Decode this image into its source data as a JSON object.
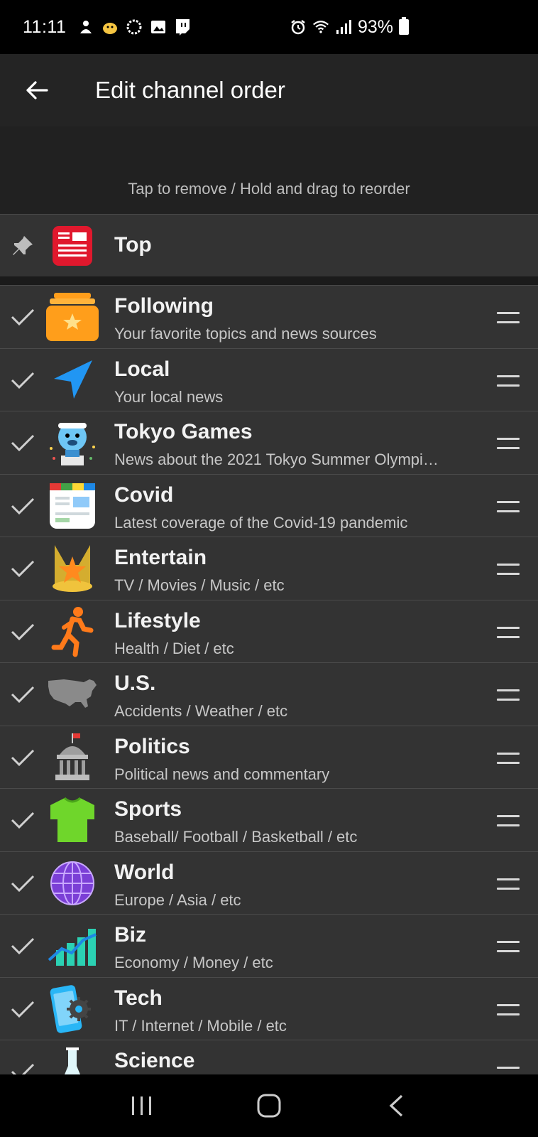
{
  "status": {
    "time": "11:11",
    "battery": "93%"
  },
  "appbar": {
    "title": "Edit channel order"
  },
  "hint": "Tap to remove / Hold and drag to reorder",
  "pinned": {
    "title": "Top",
    "icon": "newspaper-icon",
    "color": "#e0182d"
  },
  "channels": [
    {
      "title": "Following",
      "subtitle": "Your favorite topics and news sources",
      "icon": "star-folder-icon",
      "checked": true
    },
    {
      "title": "Local",
      "subtitle": "Your local news",
      "icon": "location-arrow-icon",
      "checked": true
    },
    {
      "title": "Tokyo Games",
      "subtitle": "News about the 2021 Tokyo Summer Olympi…",
      "icon": "mascot-icon",
      "checked": true
    },
    {
      "title": "Covid",
      "subtitle": "Latest coverage of the Covid-19 pandemic",
      "icon": "news-card-icon",
      "checked": true
    },
    {
      "title": "Entertain",
      "subtitle": "TV / Movies / Music / etc",
      "icon": "spotlight-star-icon",
      "checked": true
    },
    {
      "title": "Lifestyle",
      "subtitle": "Health / Diet / etc",
      "icon": "runner-icon",
      "checked": true
    },
    {
      "title": "U.S.",
      "subtitle": "Accidents / Weather / etc",
      "icon": "usa-map-icon",
      "checked": true
    },
    {
      "title": "Politics",
      "subtitle": "Political news and commentary",
      "icon": "capitol-icon",
      "checked": true
    },
    {
      "title": "Sports",
      "subtitle": "Baseball/ Football / Basketball / etc",
      "icon": "jersey-icon",
      "checked": true
    },
    {
      "title": "World",
      "subtitle": "Europe / Asia / etc",
      "icon": "globe-icon",
      "checked": true
    },
    {
      "title": "Biz",
      "subtitle": "Economy / Money / etc",
      "icon": "bar-chart-icon",
      "checked": true
    },
    {
      "title": "Tech",
      "subtitle": "IT / Internet / Mobile / etc",
      "icon": "phone-gear-icon",
      "checked": true
    },
    {
      "title": "Science",
      "subtitle": "",
      "icon": "flask-icon",
      "checked": true
    }
  ],
  "colors": {
    "appbar": "#242424",
    "row": "#333333",
    "divider": "#4a4a4a",
    "accent_orange": "#ff9e1b",
    "accent_blue": "#2196f3",
    "accent_green": "#6fd62b",
    "accent_purple": "#7b3fd6",
    "accent_teal": "#2bd1b3"
  }
}
